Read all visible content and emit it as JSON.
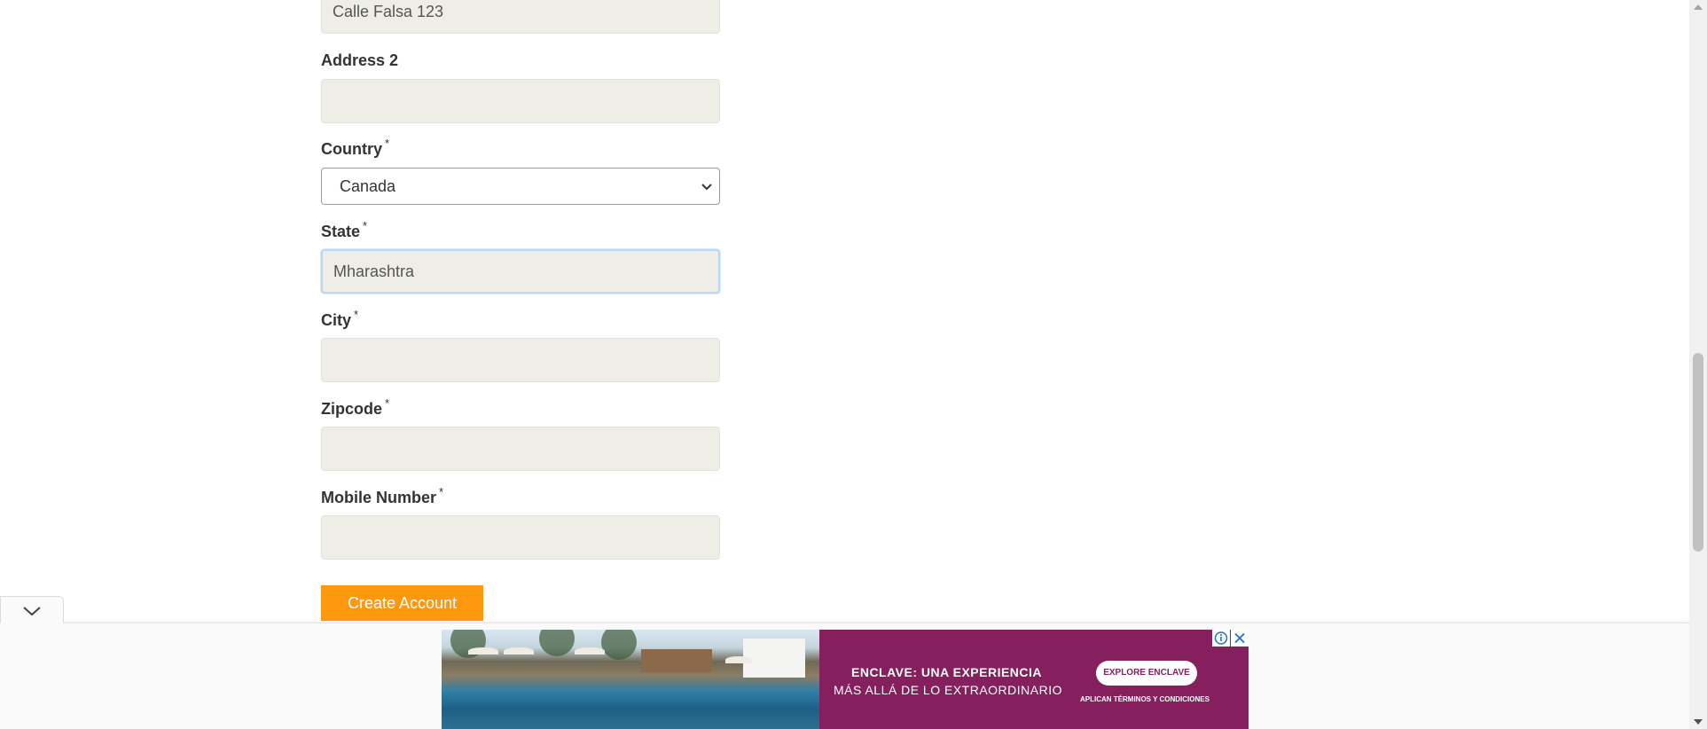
{
  "form": {
    "address1": {
      "value": "Calle Falsa 123"
    },
    "address2": {
      "label": "Address 2",
      "value": ""
    },
    "country": {
      "label": "Country",
      "required_mark": "*",
      "selected": "Canada"
    },
    "state": {
      "label": "State",
      "required_mark": "*",
      "value": "Mharashtra"
    },
    "city": {
      "label": "City",
      "required_mark": "*",
      "value": ""
    },
    "zipcode": {
      "label": "Zipcode",
      "required_mark": "*",
      "value": ""
    },
    "mobile": {
      "label": "Mobile Number",
      "required_mark": "*",
      "value": ""
    },
    "submit_label": "Create Account"
  },
  "ad": {
    "headline": "ENCLAVE: UNA EXPERIENCIA",
    "subline": "MÁS ALLÁ DE LO EXTRAORDINARIO",
    "cta": "EXPLORE ENCLAVE",
    "terms": "APLICAN TÉRMINOS Y CONDICIONES"
  },
  "colors": {
    "button": "#fe980f",
    "input_bg": "#eeede6",
    "ad_panel": "#851f5d",
    "focus_ring": "#b9d8f5"
  }
}
